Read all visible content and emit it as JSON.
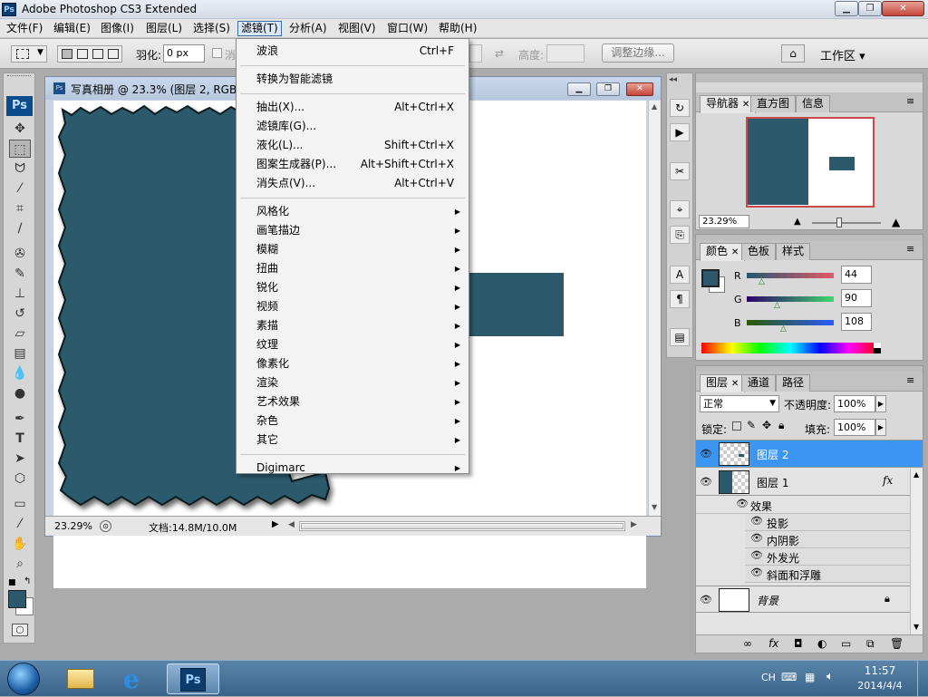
{
  "app": {
    "title": "Adobe Photoshop CS3 Extended",
    "ps_mini": "Ps"
  },
  "menubar": [
    "文件(F)",
    "编辑(E)",
    "图像(I)",
    "图层(L)",
    "选择(S)",
    "滤镜(T)",
    "分析(A)",
    "视图(V)",
    "窗口(W)",
    "帮助(H)"
  ],
  "options": {
    "feather_label": "羽化:",
    "feather_value": "0 px",
    "antialias_label": "消",
    "height_label": "高度:",
    "refine_edge": "调整边缘...",
    "workspace": "工作区 ▾"
  },
  "document": {
    "title": "写真相册 @ 23.3% (图层 2, RGB/",
    "zoom": "23.29%",
    "doc_info": "文档:14.8M/10.0M"
  },
  "filter_menu": [
    {
      "label": "波浪",
      "shortcut": "Ctrl+F"
    },
    {
      "sep": true
    },
    {
      "label": "转换为智能滤镜"
    },
    {
      "sep": true
    },
    {
      "label": "抽出(X)...",
      "shortcut": "Alt+Ctrl+X"
    },
    {
      "label": "滤镜库(G)..."
    },
    {
      "label": "液化(L)...",
      "shortcut": "Shift+Ctrl+X"
    },
    {
      "label": "图案生成器(P)...",
      "shortcut": "Alt+Shift+Ctrl+X"
    },
    {
      "label": "消失点(V)...",
      "shortcut": "Alt+Ctrl+V"
    },
    {
      "sep": true
    },
    {
      "label": "风格化",
      "sub": true
    },
    {
      "label": "画笔描边",
      "sub": true
    },
    {
      "label": "模糊",
      "sub": true
    },
    {
      "label": "扭曲",
      "sub": true
    },
    {
      "label": "锐化",
      "sub": true
    },
    {
      "label": "视频",
      "sub": true
    },
    {
      "label": "素描",
      "sub": true
    },
    {
      "label": "纹理",
      "sub": true
    },
    {
      "label": "像素化",
      "sub": true
    },
    {
      "label": "渲染",
      "sub": true
    },
    {
      "label": "艺术效果",
      "sub": true
    },
    {
      "label": "杂色",
      "sub": true
    },
    {
      "label": "其它",
      "sub": true
    },
    {
      "sep": true
    },
    {
      "label": "Digimarc",
      "sub": true
    }
  ],
  "navigator": {
    "tabs": [
      "导航器",
      "直方图",
      "信息"
    ],
    "zoom": "23.29%"
  },
  "color": {
    "tabs": [
      "颜色",
      "色板",
      "样式"
    ],
    "r": "44",
    "g": "90",
    "b": "108",
    "labels": [
      "R",
      "G",
      "B"
    ],
    "swatch": "#2c5a6c"
  },
  "layers": {
    "tabs": [
      "图层",
      "通道",
      "路径"
    ],
    "blend_mode": "正常",
    "opacity_label": "不透明度:",
    "opacity": "100%",
    "lock_label": "锁定:",
    "fill_label": "填充:",
    "fill": "100%",
    "items": [
      {
        "name": "图层 2",
        "selected": true
      },
      {
        "name": "图层 1",
        "fx": "fx"
      },
      {
        "name": "背景",
        "locked": true
      }
    ],
    "effects_label": "效果",
    "effects": [
      "投影",
      "内阴影",
      "外发光",
      "斜面和浮雕"
    ]
  },
  "taskbar": {
    "ime": "CH",
    "time": "11:57",
    "date": "2014/4/4"
  },
  "colors": {
    "accent": "#3b95f3",
    "canvas_teal": "#2c5a6c"
  }
}
